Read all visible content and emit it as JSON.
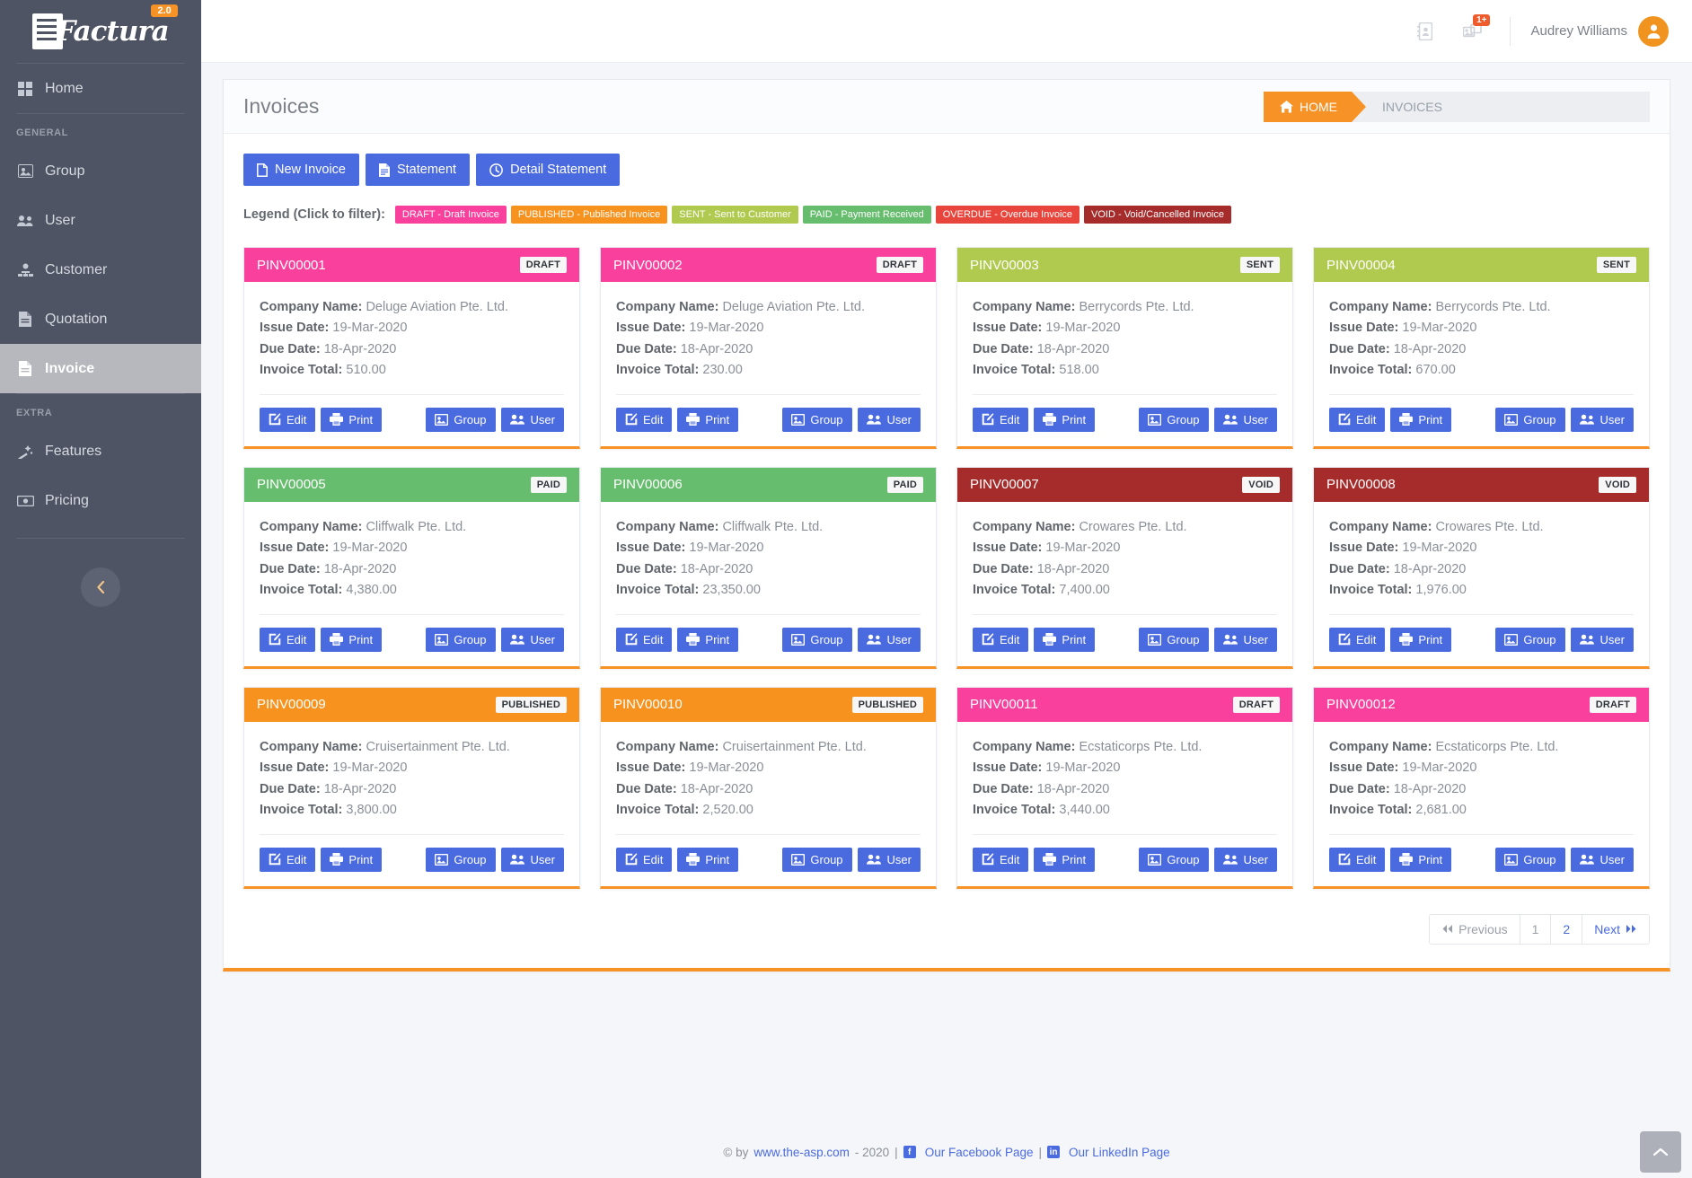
{
  "brand": {
    "name": "Factura",
    "version": "2.0"
  },
  "sidebar": {
    "collapse_icon": "chevron-left-icon",
    "groups": [
      {
        "label": "",
        "items": [
          {
            "label": "Home",
            "icon": "grid-icon",
            "active": false
          }
        ]
      },
      {
        "label": "GENERAL",
        "items": [
          {
            "label": "Group",
            "icon": "group-icon",
            "active": false
          },
          {
            "label": "User",
            "icon": "users-icon",
            "active": false
          },
          {
            "label": "Customer",
            "icon": "customer-icon",
            "active": false
          },
          {
            "label": "Quotation",
            "icon": "quotation-icon",
            "active": false
          },
          {
            "label": "Invoice",
            "icon": "invoice-icon",
            "active": true
          }
        ]
      },
      {
        "label": "EXTRA",
        "items": [
          {
            "label": "Features",
            "icon": "magic-wand-icon",
            "active": false
          },
          {
            "label": "Pricing",
            "icon": "money-icon",
            "active": false
          }
        ]
      }
    ]
  },
  "topbar": {
    "address_book_icon": "address-book-icon",
    "gallery_icon": "gallery-icon",
    "notification_badge": "1+",
    "user_name": "Audrey Williams",
    "avatar_icon": "user-avatar-icon"
  },
  "header": {
    "title": "Invoices",
    "breadcrumb": {
      "home": "HOME",
      "current": "INVOICES",
      "home_icon": "home-icon"
    }
  },
  "toolbar": {
    "new_invoice": "New Invoice",
    "statement": "Statement",
    "detail_statement": "Detail Statement"
  },
  "legend": {
    "label": "Legend (Click to filter):",
    "chips": [
      {
        "text": "DRAFT - Draft Invoice",
        "color": "#f9409c"
      },
      {
        "text": "PUBLISHED - Published Invoice",
        "color": "#f7921e"
      },
      {
        "text": "SENT - Sent to Customer",
        "color": "#b0c94f"
      },
      {
        "text": "PAID - Payment Received",
        "color": "#67bd6e"
      },
      {
        "text": "OVERDUE - Overdue Invoice",
        "color": "#e8453c"
      },
      {
        "text": "VOID - Void/Cancelled Invoice",
        "color": "#a62b2b"
      }
    ]
  },
  "card_labels": {
    "company_name": "Company Name:",
    "issue_date": "Issue Date:",
    "due_date": "Due Date:",
    "invoice_total": "Invoice Total:",
    "edit": "Edit",
    "print": "Print",
    "group": "Group",
    "user": "User"
  },
  "status_colors": {
    "DRAFT": "#f9409c",
    "PUBLISHED": "#f7921e",
    "SENT": "#b0c94f",
    "PAID": "#67bd6e",
    "OVERDUE": "#e8453c",
    "VOID": "#a62b2b"
  },
  "invoices": [
    {
      "id": "PINV00001",
      "status": "DRAFT",
      "company": "Deluge Aviation Pte. Ltd.",
      "issue_date": "19-Mar-2020",
      "due_date": "18-Apr-2020",
      "total": "510.00"
    },
    {
      "id": "PINV00002",
      "status": "DRAFT",
      "company": "Deluge Aviation Pte. Ltd.",
      "issue_date": "19-Mar-2020",
      "due_date": "18-Apr-2020",
      "total": "230.00"
    },
    {
      "id": "PINV00003",
      "status": "SENT",
      "company": "Berrycords Pte. Ltd.",
      "issue_date": "19-Mar-2020",
      "due_date": "18-Apr-2020",
      "total": "518.00"
    },
    {
      "id": "PINV00004",
      "status": "SENT",
      "company": "Berrycords Pte. Ltd.",
      "issue_date": "19-Mar-2020",
      "due_date": "18-Apr-2020",
      "total": "670.00"
    },
    {
      "id": "PINV00005",
      "status": "PAID",
      "company": "Cliffwalk Pte. Ltd.",
      "issue_date": "19-Mar-2020",
      "due_date": "18-Apr-2020",
      "total": "4,380.00"
    },
    {
      "id": "PINV00006",
      "status": "PAID",
      "company": "Cliffwalk Pte. Ltd.",
      "issue_date": "19-Mar-2020",
      "due_date": "18-Apr-2020",
      "total": "23,350.00"
    },
    {
      "id": "PINV00007",
      "status": "VOID",
      "company": "Crowares Pte. Ltd.",
      "issue_date": "19-Mar-2020",
      "due_date": "18-Apr-2020",
      "total": "7,400.00"
    },
    {
      "id": "PINV00008",
      "status": "VOID",
      "company": "Crowares Pte. Ltd.",
      "issue_date": "19-Mar-2020",
      "due_date": "18-Apr-2020",
      "total": "1,976.00"
    },
    {
      "id": "PINV00009",
      "status": "PUBLISHED",
      "company": "Cruisertainment Pte. Ltd.",
      "issue_date": "19-Mar-2020",
      "due_date": "18-Apr-2020",
      "total": "3,800.00"
    },
    {
      "id": "PINV00010",
      "status": "PUBLISHED",
      "company": "Cruisertainment Pte. Ltd.",
      "issue_date": "19-Mar-2020",
      "due_date": "18-Apr-2020",
      "total": "2,520.00"
    },
    {
      "id": "PINV00011",
      "status": "DRAFT",
      "company": "Ecstaticorps Pte. Ltd.",
      "issue_date": "19-Mar-2020",
      "due_date": "18-Apr-2020",
      "total": "3,440.00"
    },
    {
      "id": "PINV00012",
      "status": "DRAFT",
      "company": "Ecstaticorps Pte. Ltd.",
      "issue_date": "19-Mar-2020",
      "due_date": "18-Apr-2020",
      "total": "2,681.00"
    }
  ],
  "pagination": {
    "previous": "Previous",
    "pages": [
      "1",
      "2"
    ],
    "active_page": "1",
    "next": "Next"
  },
  "footer": {
    "copyright_prefix": "© by",
    "site": "www.the-asp.com",
    "year": "- 2020",
    "sep": "|",
    "facebook": "Our Facebook Page",
    "linkedin": "Our LinkedIn Page",
    "facebook_glyph": "f",
    "linkedin_glyph": "in"
  },
  "scroll_top": {
    "icon": "chevron-up-icon"
  }
}
